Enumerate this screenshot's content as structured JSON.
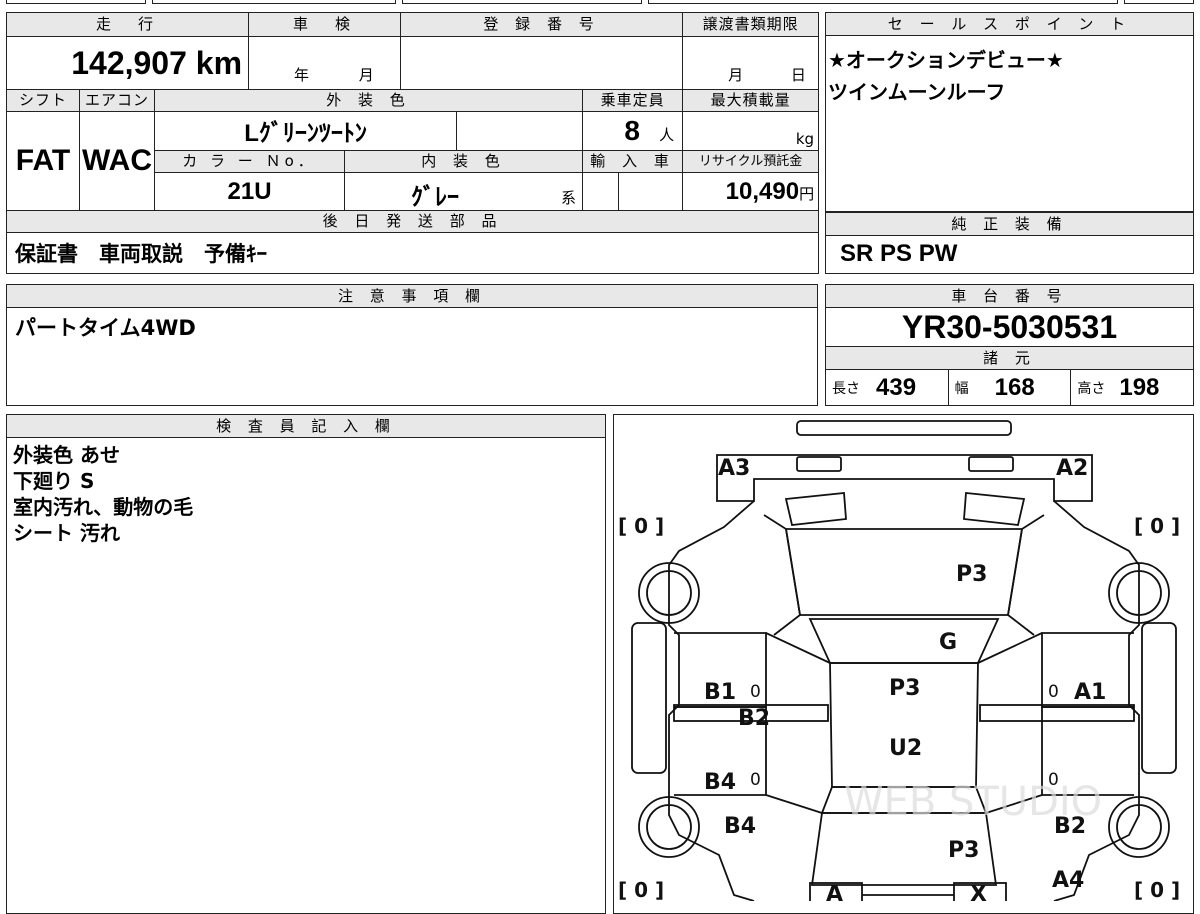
{
  "vehicle": {
    "headers": {
      "mileage": "走　行",
      "inspection": "車　検",
      "registration": "登 録 番 号",
      "transfer_deadline": "譲渡書類期限",
      "shift": "シフト",
      "aircon": "エアコン",
      "exterior_color": "外 装 色",
      "capacity": "乗車定員",
      "max_load": "最大積載量",
      "color_no": "カ ラ ー Ｎo．",
      "interior_color": "内 装 色",
      "import": "輸 入 車",
      "recycle": "リサイクル預託金",
      "later_parts": "後 日 発 送 部 品"
    },
    "mileage": "142,907 km",
    "inspection_year_unit": "年",
    "inspection_month_unit": "月",
    "transfer_month_unit": "月",
    "transfer_day_unit": "日",
    "shift": "FAT",
    "aircon": "WAC",
    "exterior_color": "Lｸﾞﾘｰﾝﾂｰﾄﾝ",
    "capacity": "8",
    "capacity_unit": "人",
    "max_load_unit": "kg",
    "color_no": "21U",
    "interior_color": "ｸﾞﾚｰ",
    "interior_suffix": "系",
    "recycle_fee": "10,490",
    "recycle_unit": "円",
    "later_parts": "保証書　車両取説　予備ｷｰ"
  },
  "sales_points": {
    "header": "セ ー ル ス ポ イ ン ト",
    "lines": [
      "★オークションデビュー★",
      "ツインムーンルーフ"
    ]
  },
  "equipment": {
    "header": "純 正 装 備",
    "value": "SR PS PW"
  },
  "notes": {
    "header": "注 意 事 項 欄",
    "value": "パートタイム4WD"
  },
  "chassis": {
    "header": "車 台 番 号",
    "value": "YR30-5030531",
    "spec_header": "諸 元",
    "length_label": "長さ",
    "length": "439",
    "width_label": "幅",
    "width": "168",
    "height_label": "高さ",
    "height": "198"
  },
  "inspector": {
    "header": "検 査 員 記 入 欄",
    "lines": [
      "外装色 あせ",
      "下廻り S",
      "室内汚れ、動物の毛",
      "シート 汚れ"
    ]
  },
  "diagram": {
    "tire_marks": [
      "[ 0 ]",
      "[ 0 ]",
      "[ 0 ]",
      "[ 0 ]"
    ],
    "codes": {
      "a3": "A3",
      "a2": "A2",
      "p3_hood": "P3",
      "g": "G",
      "b1": "B1",
      "b2_left": "B2",
      "p3_roof": "P3",
      "u2": "U2",
      "a1": "A1",
      "b4_door": "B4",
      "b4_side": "B4",
      "b2_right": "B2",
      "p3_rear": "P3",
      "a4": "A4",
      "a_tag": "A",
      "x_tag": "X",
      "zero": "0"
    },
    "watermark": "WEB STUDIO"
  }
}
